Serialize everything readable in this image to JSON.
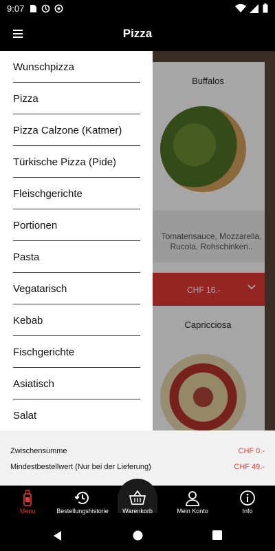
{
  "status_bar": {
    "time": "9:07"
  },
  "app_bar": {
    "title": "Pizza"
  },
  "cards": [
    {
      "title": "Buffalos",
      "description": "Tomatensauce, Mozzarella, Rucola, Rohschinken..",
      "price": "CHF 16.-"
    },
    {
      "title": "Capricciosa"
    }
  ],
  "drawer": {
    "items": [
      "Wunschpizza",
      "Pizza",
      "Pizza Calzone (Katmer)",
      "Türkische Pizza (Pide)",
      "Fleischgerichte",
      "Portionen",
      "Pasta",
      "Vegatarisch",
      "Kebab",
      "Fischgerichte",
      "Asiatisch",
      "Salat"
    ]
  },
  "summary": {
    "subtotal_label": "Zwischensumme",
    "subtotal_value": "CHF 0.-",
    "minimum_label": "Mindestbestellwert (Nur bei der Lieferung)",
    "minimum_value": "CHF 49.-"
  },
  "bottom_nav": {
    "menu": "Menu",
    "history": "Bestellungshistorie",
    "basket": "Warenkorb",
    "account": "Mein Konto",
    "info": "Info"
  },
  "colors": {
    "accent": "#e53935",
    "bar_background": "#000000"
  },
  "icons": {
    "app_bar": "hamburger-menu-icon",
    "nav": [
      "menu-icon",
      "history-icon",
      "basket-icon",
      "account-icon",
      "info-icon"
    ],
    "system": [
      "back-icon",
      "home-icon",
      "recents-icon"
    ]
  }
}
